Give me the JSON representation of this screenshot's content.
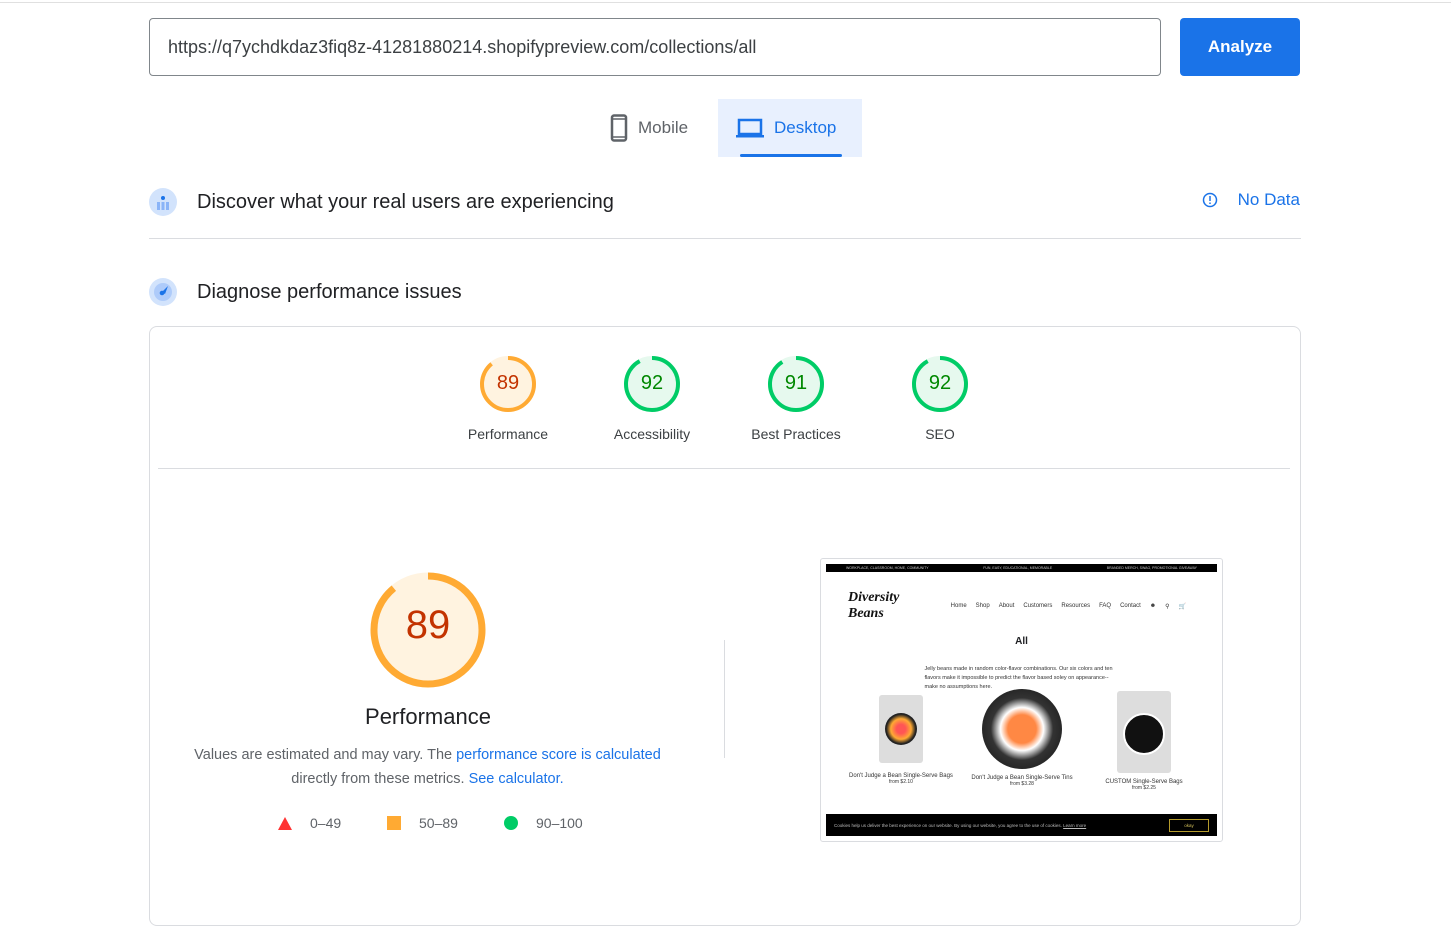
{
  "url_input": {
    "value": "https://q7ychdkdaz3fiq8z-41281880214.shopifypreview.com/collections/all"
  },
  "analyze_label": "Analyze",
  "tabs": [
    {
      "label": "Mobile",
      "icon": "phone-icon",
      "selected": false
    },
    {
      "label": "Desktop",
      "icon": "laptop-icon",
      "selected": true
    }
  ],
  "field_section": {
    "title": "Discover what your real users are experiencing",
    "status": "No Data",
    "status_icon": "info-icon"
  },
  "lab_section": {
    "title": "Diagnose performance issues"
  },
  "scores": [
    {
      "label": "Performance",
      "value": 89,
      "color": "#fa3",
      "text_color": "#c33300",
      "bg": "#fff3e0"
    },
    {
      "label": "Accessibility",
      "value": 92,
      "color": "#0c6",
      "text_color": "#008800",
      "bg": "#e6f9ee"
    },
    {
      "label": "Best Practices",
      "value": 91,
      "color": "#0c6",
      "text_color": "#008800",
      "bg": "#e6f9ee"
    },
    {
      "label": "SEO",
      "value": 92,
      "color": "#0c6",
      "text_color": "#008800",
      "bg": "#e6f9ee"
    }
  ],
  "main_score": {
    "value": 89,
    "label": "Performance"
  },
  "description": {
    "text1": "Values are estimated and may vary. The ",
    "link1": "performance score is calculated",
    "text2": " directly from these metrics. ",
    "link2": "See calculator."
  },
  "legend": [
    {
      "range": "0–49",
      "shape": "triangle",
      "color": "#f33"
    },
    {
      "range": "50–89",
      "shape": "square",
      "color": "#fa3"
    },
    {
      "range": "90–100",
      "shape": "circle",
      "color": "#0c6"
    }
  ],
  "screenshot": {
    "banner": [
      "WORKPLACE, CLASSROOM, HOME, COMMUNITY",
      "FUN, EASY, EDUCATIONAL, MEMORABLE",
      "BRANDED MERCH, SWAG, PROMOTIONAL GIVEAWAY"
    ],
    "logo": "Diversity Beans",
    "nav": [
      "Home",
      "Shop",
      "About",
      "Customers",
      "Resources",
      "FAQ",
      "Contact"
    ],
    "heading": "All",
    "intro": "Jelly beans made in random color-flavor combinations. Our six colors and ten flavors make it impossible to predict the flavor based soley on appearance--make no assumptions here.",
    "products": [
      {
        "name": "Don't Judge a Bean Single-Serve Bags",
        "price": "from $2.10"
      },
      {
        "name": "Don't Judge a Bean Single-Serve Tins",
        "price": "from $3.28"
      },
      {
        "name": "CUSTOM Single-Serve Bags",
        "price": "from $2.25"
      }
    ],
    "cookie_text": "Cookies help us deliver the best experience on our website. By using our website, you agree to the use of cookies.",
    "cookie_link": "Learn more",
    "cookie_button": "okay"
  }
}
